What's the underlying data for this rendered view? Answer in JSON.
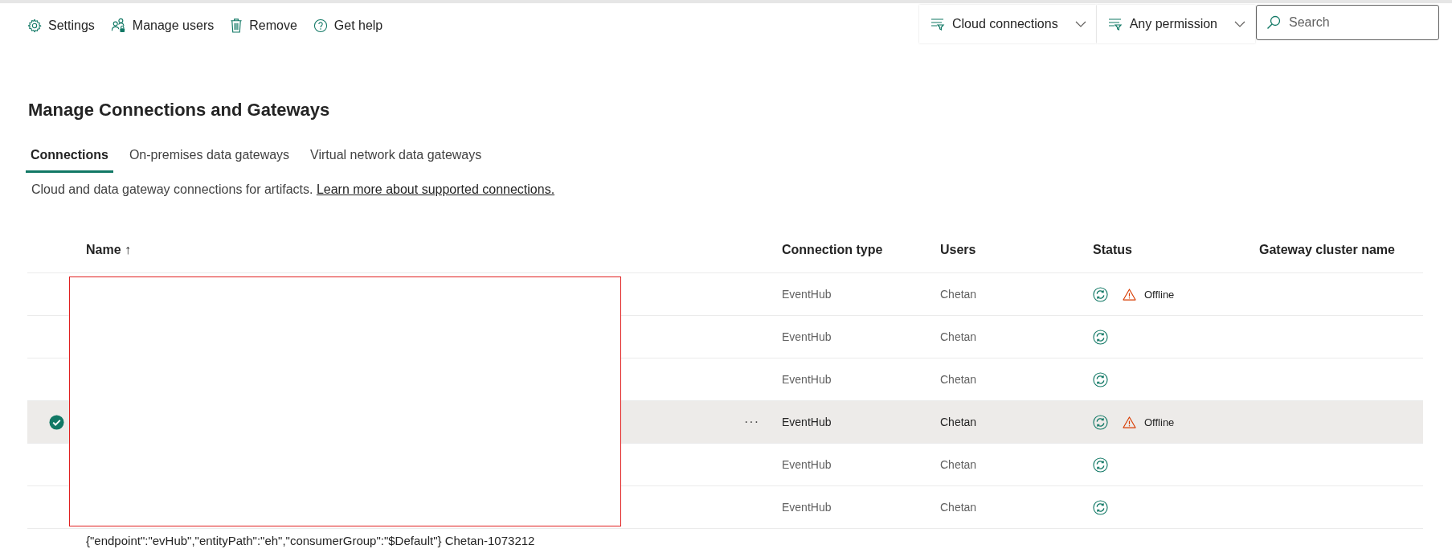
{
  "toolbar": [
    {
      "kind": "settings",
      "label": "Settings"
    },
    {
      "kind": "users",
      "label": "Manage users"
    },
    {
      "kind": "remove",
      "label": "Remove"
    },
    {
      "kind": "help",
      "label": "Get help"
    }
  ],
  "filters": [
    {
      "label": "Cloud connections"
    },
    {
      "label": "Any permission"
    }
  ],
  "search": {
    "placeholder": "Search"
  },
  "title": "Manage Connections and Gateways",
  "tabs": [
    {
      "label": "Connections",
      "selected": true
    },
    {
      "label": "On-premises data gateways",
      "selected": false
    },
    {
      "label": "Virtual network data gateways",
      "selected": false
    }
  ],
  "description": {
    "text": "Cloud and data gateway connections for artifacts.",
    "link": "Learn more about supported connections."
  },
  "table": {
    "columns": [
      "Name ↑",
      "Connection type",
      "Users",
      "Status",
      "Gateway cluster name"
    ],
    "rows": [
      {
        "selected": false,
        "connection_type": "EventHub",
        "users": "Chetan",
        "offline": true,
        "status_text": "Offline"
      },
      {
        "selected": false,
        "connection_type": "EventHub",
        "users": "Chetan",
        "offline": false
      },
      {
        "selected": false,
        "connection_type": "EventHub",
        "users": "Chetan",
        "offline": false
      },
      {
        "selected": true,
        "connection_type": "EventHub",
        "users": "Chetan",
        "offline": true,
        "status_text": "Offline",
        "more": "···"
      },
      {
        "selected": false,
        "connection_type": "EventHub",
        "users": "Chetan",
        "offline": false
      },
      {
        "selected": false,
        "connection_type": "EventHub",
        "users": "Chetan",
        "offline": false
      },
      {
        "selected": false,
        "name": "{\"endpoint\":\"evHub\",\"entityPath\":\"eh\",\"consumerGroup\":\"$Default\"} Chetan-1073212"
      }
    ]
  }
}
